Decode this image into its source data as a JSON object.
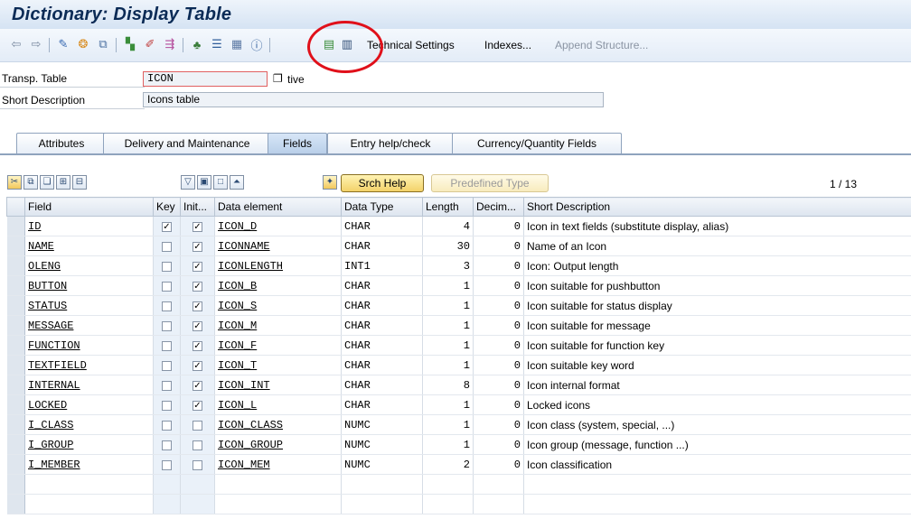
{
  "window": {
    "title": "Dictionary: Display Table"
  },
  "toolbar": {
    "icons": [
      "back-arrow-icon",
      "forward-arrow-icon",
      "display-change-icon",
      "activate-icon",
      "where-used-icon",
      "object-list-icon",
      "edit-icon",
      "transport-icon",
      "hierarchy-icon",
      "list-icon",
      "grid-icon",
      "info-icon",
      "columns-icon",
      "table-icon"
    ],
    "technical_settings": "Technical Settings",
    "indexes": "Indexes...",
    "append_structure": "Append Structure..."
  },
  "header": {
    "transp_table_label": "Transp. Table",
    "transp_table_value": "ICON",
    "status_text": "tive",
    "short_description_label": "Short Description",
    "short_description_value": "Icons table"
  },
  "tabs": [
    {
      "label": "Attributes",
      "active": false
    },
    {
      "label": "Delivery and Maintenance",
      "active": false
    },
    {
      "label": "Fields",
      "active": true
    },
    {
      "label": "Entry help/check",
      "active": false
    },
    {
      "label": "Currency/Quantity Fields",
      "active": false
    }
  ],
  "grid_toolbar": {
    "srch_help": "Srch Help",
    "predefined_type": "Predefined Type",
    "pager": "1  /  13"
  },
  "columns": [
    "Field",
    "Key",
    "Init...",
    "Data element",
    "Data Type",
    "Length",
    "Decim...",
    "Short Description"
  ],
  "rows": [
    {
      "field": "ID",
      "key": true,
      "init": true,
      "data_element": "ICON_D",
      "data_type": "CHAR",
      "length": "4",
      "decimals": "0",
      "description": "Icon in text fields (substitute display, alias)"
    },
    {
      "field": "NAME",
      "key": false,
      "init": true,
      "data_element": "ICONNAME",
      "data_type": "CHAR",
      "length": "30",
      "decimals": "0",
      "description": "Name of an Icon"
    },
    {
      "field": "OLENG",
      "key": false,
      "init": true,
      "data_element": "ICONLENGTH",
      "data_type": "INT1",
      "length": "3",
      "decimals": "0",
      "description": "Icon: Output length"
    },
    {
      "field": "BUTTON",
      "key": false,
      "init": true,
      "data_element": "ICON_B",
      "data_type": "CHAR",
      "length": "1",
      "decimals": "0",
      "description": "Icon suitable for pushbutton"
    },
    {
      "field": "STATUS",
      "key": false,
      "init": true,
      "data_element": "ICON_S",
      "data_type": "CHAR",
      "length": "1",
      "decimals": "0",
      "description": "Icon suitable for status display"
    },
    {
      "field": "MESSAGE",
      "key": false,
      "init": true,
      "data_element": "ICON_M",
      "data_type": "CHAR",
      "length": "1",
      "decimals": "0",
      "description": "Icon suitable for message"
    },
    {
      "field": "FUNCTION",
      "key": false,
      "init": true,
      "data_element": "ICON_F",
      "data_type": "CHAR",
      "length": "1",
      "decimals": "0",
      "description": "Icon suitable for function key"
    },
    {
      "field": "TEXTFIELD",
      "key": false,
      "init": true,
      "data_element": "ICON_T",
      "data_type": "CHAR",
      "length": "1",
      "decimals": "0",
      "description": "Icon suitable key word"
    },
    {
      "field": "INTERNAL",
      "key": false,
      "init": true,
      "data_element": "ICON_INT",
      "data_type": "CHAR",
      "length": "8",
      "decimals": "0",
      "description": "Icon internal format"
    },
    {
      "field": "LOCKED",
      "key": false,
      "init": true,
      "data_element": "ICON_L",
      "data_type": "CHAR",
      "length": "1",
      "decimals": "0",
      "description": "Locked icons"
    },
    {
      "field": "I_CLASS",
      "key": false,
      "init": false,
      "data_element": "ICON_CLASS",
      "data_type": "NUMC",
      "length": "1",
      "decimals": "0",
      "description": "Icon class (system, special, ...)"
    },
    {
      "field": "I_GROUP",
      "key": false,
      "init": false,
      "data_element": "ICON_GROUP",
      "data_type": "NUMC",
      "length": "1",
      "decimals": "0",
      "description": "Icon group (message, function ...)"
    },
    {
      "field": "I_MEMBER",
      "key": false,
      "init": false,
      "data_element": "ICON_MEM",
      "data_type": "NUMC",
      "length": "2",
      "decimals": "0",
      "description": "Icon classification"
    }
  ],
  "colors": {
    "title": "#0b2b56",
    "annotation_circle": "#e0101a",
    "button_yellow": "#f3d26a",
    "key_column": "#eaf1f9"
  }
}
